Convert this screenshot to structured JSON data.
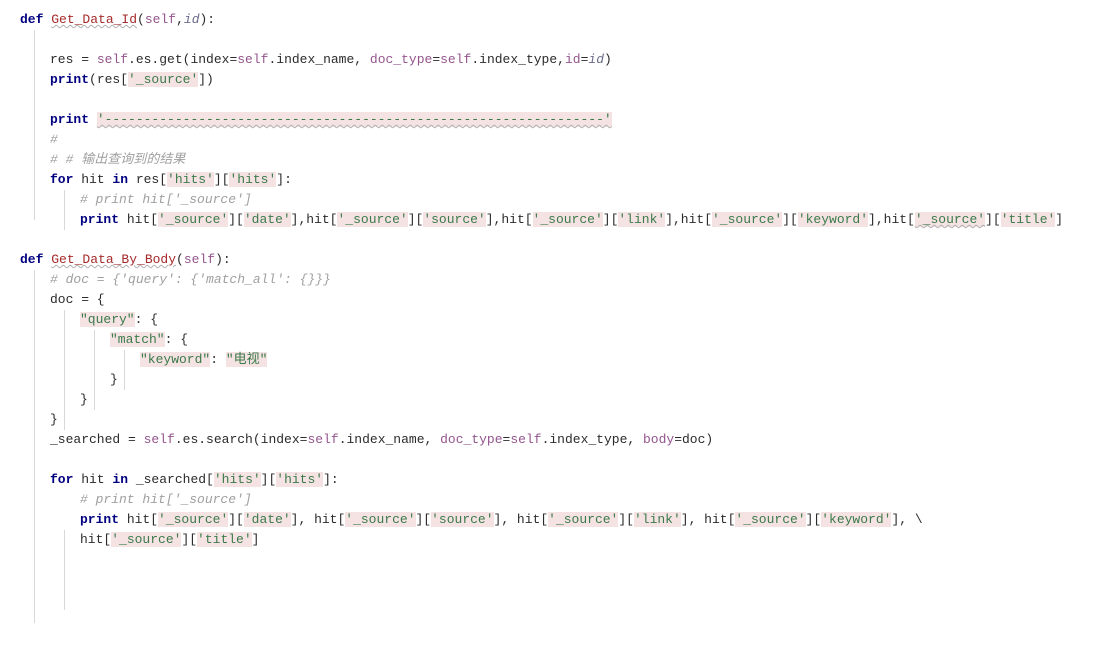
{
  "code": {
    "l1_def": "def",
    "l1_fn": "Get_Data_Id",
    "l1_self": "self",
    "l1_id": "id",
    "l3_res": "res = ",
    "l3_self": "self",
    "l3_es": ".es.get(index=",
    "l3_self2": "self",
    "l3_idxname": ".index_name, ",
    "l3_doctype": "doc_type",
    "l3_eq": "=",
    "l3_self3": "self",
    "l3_idxtype": ".index_type,",
    "l3_idparam": "id",
    "l3_eq2": "=",
    "l3_idvar": "id",
    "l3_close": ")",
    "l4_print": "print",
    "l4_rest": "(res[",
    "l4_src": "'_source'",
    "l4_close": "])",
    "l6_print": "print",
    "l6_dashes": "'----------------------------------------------------------------'",
    "l7_hash": "#",
    "l8_comment": "# # 输出查询到的结果",
    "l9_for": "for",
    "l9_hit": " hit ",
    "l9_in": "in",
    "l9_res": " res[",
    "l9_hits1": "'hits'",
    "l9_mid": "][",
    "l9_hits2": "'hits'",
    "l9_close": "]:",
    "l10_comment": "# print hit['_source']",
    "l11_print": "print",
    "l11_hit": " hit[",
    "l11_src": "'_source'",
    "l11_b1": "][",
    "l11_date": "'date'",
    "l11_b2": "],hit[",
    "l11_src2": "'_source'",
    "l11_b3": "][",
    "l11_source": "'source'",
    "l11_b4": "],hit[",
    "l11_src3": "'_source'",
    "l11_b5": "][",
    "l11_link": "'link'",
    "l11_b6": "],hit[",
    "l11_src4": "'_source'",
    "l11_b7": "][",
    "l11_keyword": "'keyword'",
    "l11_b8": "],hit[",
    "l11_src5": "'_source'",
    "l11_b9": "][",
    "l11_title": "'title'",
    "l11_b10": "]",
    "l13_def": "def",
    "l13_fn": "Get_Data_By_Body",
    "l13_self": "self",
    "l14_comment": "# doc = {'query': {'match_all': {}}}",
    "l15_doc": "doc = {",
    "l16_query": "\"query\"",
    "l16_colon": ": {",
    "l17_match": "\"match\"",
    "l17_colon": ": {",
    "l18_keyword": "\"keyword\"",
    "l18_colon": ": ",
    "l18_tv": "\"电视\"",
    "l19_close": "}",
    "l20_close": "}",
    "l21_close": "}",
    "l22_searched": "_searched = ",
    "l22_self": "self",
    "l22_search": ".es.search(index=",
    "l22_self2": "self",
    "l22_idxname": ".index_name, ",
    "l22_doctype": "doc_type",
    "l22_eq": "=",
    "l22_self3": "self",
    "l22_idxtype": ".index_type, ",
    "l22_body": "body",
    "l22_eq2": "=doc)",
    "l24_for": "for",
    "l24_hit": " hit ",
    "l24_in": "in",
    "l24_searched": " _searched[",
    "l24_hits1": "'hits'",
    "l24_mid": "][",
    "l24_hits2": "'hits'",
    "l24_close": "]:",
    "l25_comment": "# print hit['_source']",
    "l26_print": "print",
    "l26_hit": " hit[",
    "l26_src": "'_source'",
    "l26_b1": "][",
    "l26_date": "'date'",
    "l26_b2": "], hit[",
    "l26_src2": "'_source'",
    "l26_b3": "][",
    "l26_source": "'source'",
    "l26_b4": "], hit[",
    "l26_src3": "'_source'",
    "l26_b5": "][",
    "l26_link": "'link'",
    "l26_b6": "], hit[",
    "l26_src4": "'_source'",
    "l26_b7": "][",
    "l26_keyword": "'keyword'",
    "l26_b8": "], \\",
    "l27_hit": "hit[",
    "l27_src": "'_source'",
    "l27_b1": "][",
    "l27_title": "'title'",
    "l27_b2": "]"
  }
}
